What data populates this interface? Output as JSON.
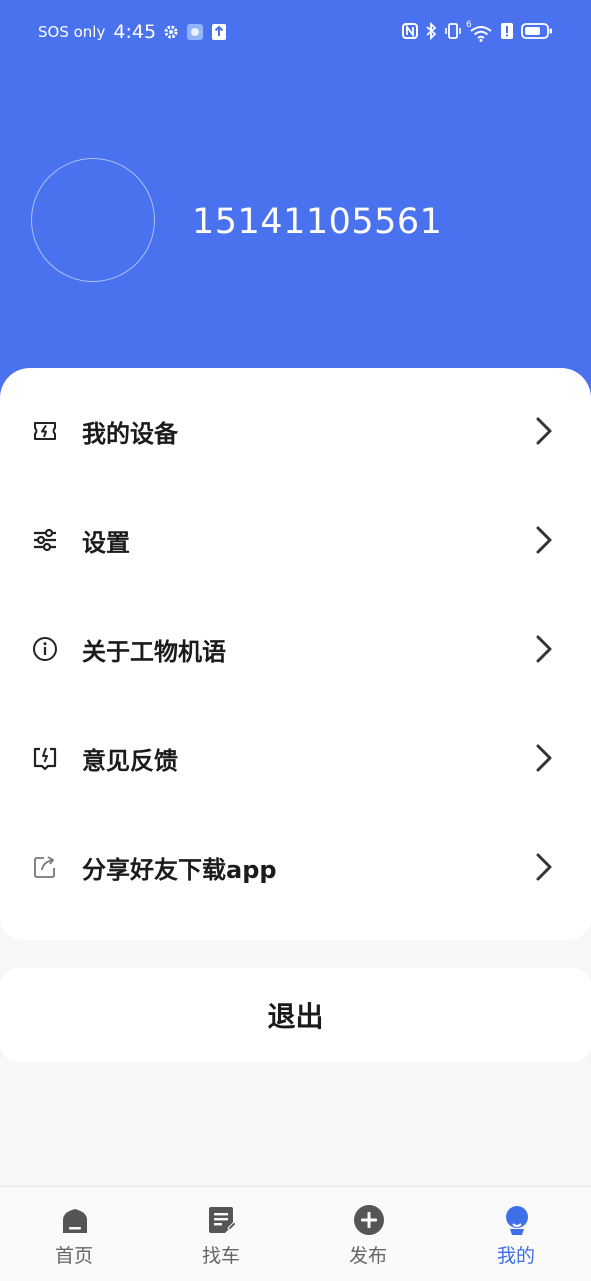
{
  "status_bar": {
    "carrier": "SOS only",
    "time": "4:45",
    "network_tag": "6"
  },
  "profile": {
    "phone": "15141105561"
  },
  "menu": {
    "items": [
      {
        "label": "我的设备",
        "icon": "device-lightning-icon"
      },
      {
        "label": "设置",
        "icon": "sliders-icon"
      },
      {
        "label": "关于工物机语",
        "icon": "info-icon"
      },
      {
        "label": "意见反馈",
        "icon": "feedback-icon"
      },
      {
        "label": "分享好友下载app",
        "icon": "share-icon"
      }
    ]
  },
  "logout": {
    "label": "退出"
  },
  "tabbar": {
    "tabs": [
      {
        "label": "首页",
        "icon": "home-icon"
      },
      {
        "label": "找车",
        "icon": "find-car-doc-icon"
      },
      {
        "label": "发布",
        "icon": "publish-plus-icon"
      },
      {
        "label": "我的",
        "icon": "profile-icon"
      }
    ],
    "active_index": 3
  },
  "colors": {
    "header": "#4a72ef",
    "accent": "#3f6fe6",
    "tab_inactive": "#666666"
  }
}
